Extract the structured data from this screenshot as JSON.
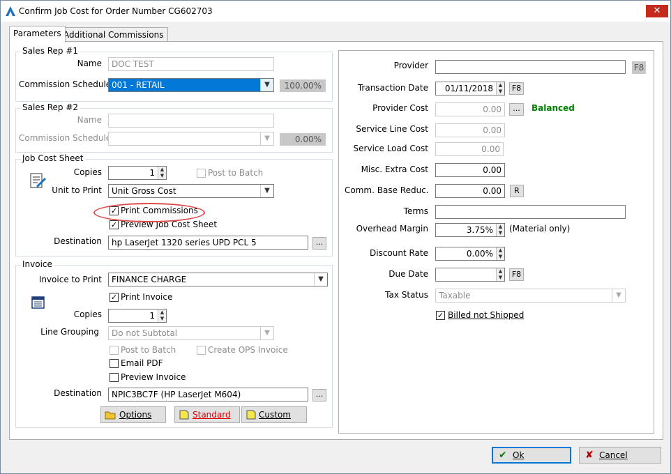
{
  "window": {
    "title": "Confirm Job Cost for Order Number CG602703",
    "close_glyph": "✕"
  },
  "tabs": [
    "Parameters",
    "Additional Commissions"
  ],
  "sales_rep_1": {
    "group_label": "Sales Rep #1",
    "name_label": "Name",
    "name_value": "DOC TEST",
    "schedule_label": "Commission Schedule",
    "schedule_value": "001 - RETAIL",
    "percent": "100.00%"
  },
  "sales_rep_2": {
    "group_label": "Sales Rep #2",
    "name_label": "Name",
    "name_value": "",
    "schedule_label": "Commission Schedule",
    "schedule_value": "",
    "percent": "0.00%"
  },
  "job_cost_sheet": {
    "group_label": "Job Cost Sheet",
    "copies_label": "Copies",
    "copies_value": "1",
    "post_to_batch": "Post to Batch",
    "unit_label": "Unit to Print",
    "unit_value": "Unit Gross Cost",
    "print_commissions": "Print Commissions",
    "preview": "Preview Job Cost Sheet",
    "destination_label": "Destination",
    "destination_value": "hp LaserJet 1320 series UPD PCL 5"
  },
  "invoice": {
    "group_label": "Invoice",
    "invoice_label": "Invoice to Print",
    "invoice_value": "FINANCE CHARGE",
    "print_invoice": "Print Invoice",
    "copies_label": "Copies",
    "copies_value": "1",
    "grouping_label": "Line Grouping",
    "grouping_value": "Do not Subtotal",
    "post_to_batch": "Post to Batch",
    "create_ops": "Create OPS Invoice",
    "email_pdf": "Email PDF",
    "preview_invoice": "Preview Invoice",
    "destination_label": "Destination",
    "destination_value": "NPIC3BC7F (HP LaserJet M604)",
    "options_btn": "Options",
    "standard_btn": "Standard",
    "custom_btn": "Custom"
  },
  "right": {
    "provider_label": "Provider",
    "provider_value": "",
    "transaction_date_label": "Transaction Date",
    "transaction_date_value": "01/11/2018",
    "provider_cost_label": "Provider Cost",
    "provider_cost_value": "0.00",
    "balanced": "Balanced",
    "service_line_label": "Service Line Cost",
    "service_line_value": "0.00",
    "service_load_label": "Service Load Cost",
    "service_load_value": "0.00",
    "misc_label": "Misc. Extra Cost",
    "misc_value": "0.00",
    "comm_base_label": "Comm. Base Reduc.",
    "comm_base_value": "0.00",
    "terms_label": "Terms",
    "terms_value": "",
    "overhead_label": "Overhead Margin",
    "overhead_value": "3.75%",
    "material_only": "(Material only)",
    "discount_label": "Discount Rate",
    "discount_value": "0.00%",
    "due_date_label": "Due Date",
    "due_date_value": "",
    "tax_status_label": "Tax Status",
    "tax_status_value": "Taxable",
    "billed_not_shipped": "Billed not Shipped"
  },
  "buttons": {
    "f8": "F8",
    "ellipsis": "...",
    "r": "R",
    "ok": "Ok",
    "cancel": "Cancel"
  },
  "colors": {
    "accent": "#0078d7",
    "balanced": "#008000",
    "highlight_oval": "#e04a4a",
    "standard_text": "#e00000"
  }
}
